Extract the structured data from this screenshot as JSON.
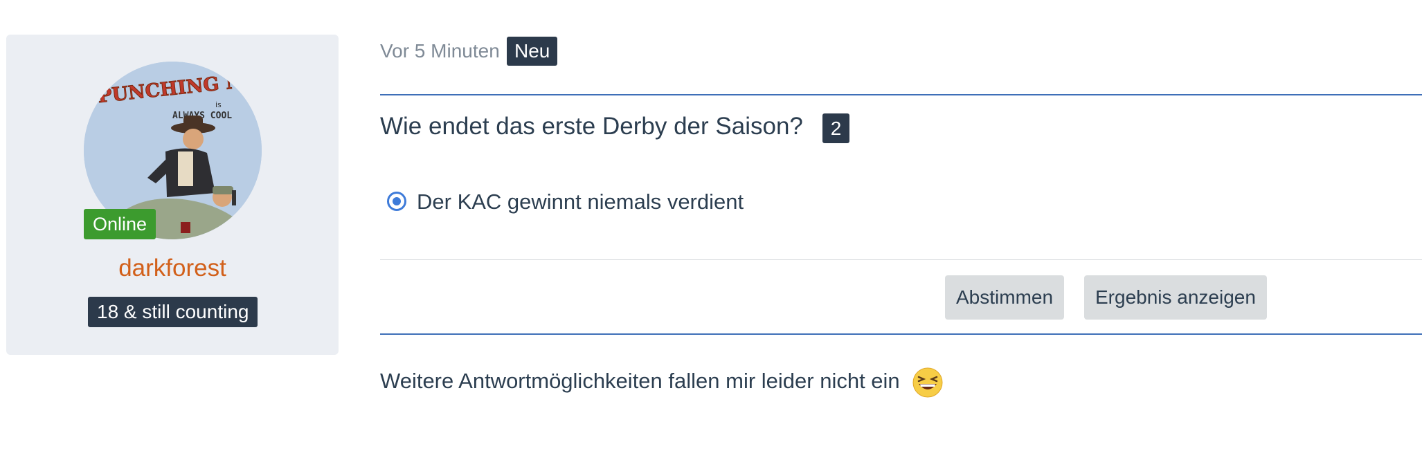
{
  "author": {
    "online_label": "Online",
    "username": "darkforest",
    "user_title": "18 & still counting",
    "avatar_text_top": "PUNCHING NAZIS",
    "avatar_text_small": "is",
    "avatar_text_bottom": "ALWAYS COOL"
  },
  "post": {
    "time": "Vor 5 Minuten",
    "new_badge": "Neu",
    "body": "Weitere Antwortmöglichkeiten fallen mir leider nicht ein",
    "emoji": "laughing-emoji"
  },
  "poll": {
    "question": "Wie endet das erste Derby der Saison?",
    "vote_count": "2",
    "options": [
      {
        "label": "Der KAC gewinnt niemals verdient",
        "selected": true
      }
    ],
    "vote_button": "Abstimmen",
    "results_button": "Ergebnis anzeigen"
  },
  "colors": {
    "accent_blue": "#3e6fb8",
    "online_green": "#3c9b2e",
    "username_orange": "#d2601a",
    "badge_dark": "#2c3a4b"
  }
}
